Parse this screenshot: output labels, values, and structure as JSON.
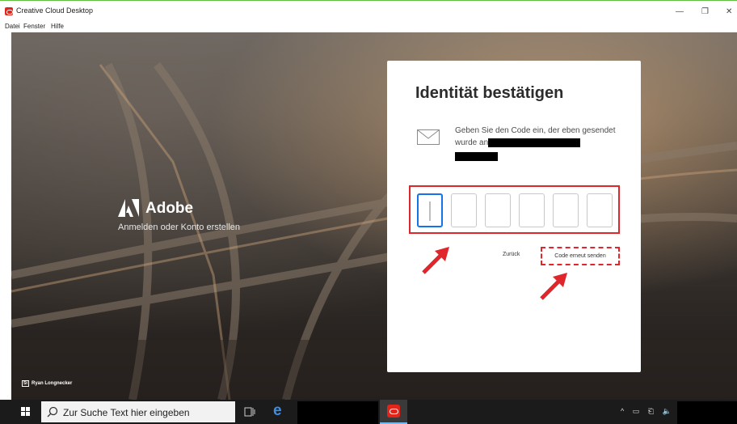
{
  "window": {
    "title": "Creative Cloud Desktop",
    "controls": {
      "minimize": "—",
      "maximize": "❐",
      "close": "✕"
    }
  },
  "menu": [
    "Datei",
    "Fenster",
    "Hilfe"
  ],
  "branding": {
    "wordmark": "Adobe",
    "tagline": "Anmelden oder Konto erstellen",
    "photo_credit_badge": "St",
    "photo_credit": "Ryan Longnecker"
  },
  "dialog": {
    "title": "Identität bestätigen",
    "message": "Geben Sie den Code ein, der eben gesendet wurde an",
    "code_digits": [
      "",
      "",
      "",
      "",
      "",
      ""
    ],
    "back_label": "Zurück",
    "resend_label": "Code erneut senden"
  },
  "taskbar": {
    "search_placeholder": "Zur Suche Text hier eingeben",
    "tray_icons": [
      "^",
      "▭",
      "⎗",
      "🔈"
    ]
  },
  "colors": {
    "accent": "#1473e6",
    "highlight": "#e0262b",
    "adobe_red": "#e1251b"
  }
}
